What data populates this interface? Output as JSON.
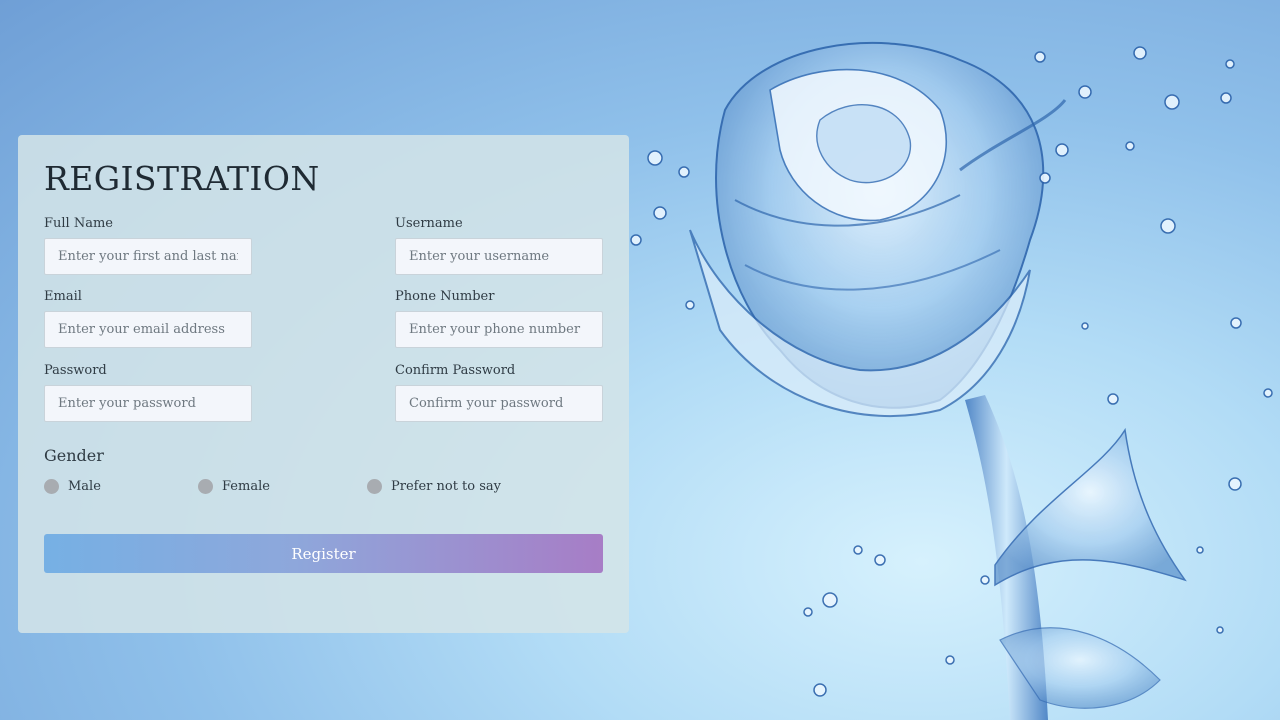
{
  "form": {
    "title": "REGISTRATION",
    "fields": {
      "full_name": {
        "label": "Full Name",
        "placeholder": "Enter your first and last name"
      },
      "username": {
        "label": "Username",
        "placeholder": "Enter your username"
      },
      "email": {
        "label": "Email",
        "placeholder": "Enter your email address"
      },
      "phone": {
        "label": "Phone Number",
        "placeholder": "Enter your phone number"
      },
      "password": {
        "label": "Password",
        "placeholder": "Enter your password"
      },
      "confirm_password": {
        "label": "Confirm Password",
        "placeholder": "Confirm your password"
      }
    },
    "gender": {
      "title": "Gender",
      "options": [
        "Male",
        "Female",
        "Prefer not to say"
      ]
    },
    "submit_label": "Register"
  },
  "colors": {
    "button_gradient_start": "#76b0e4",
    "button_gradient_end": "#a77dc6",
    "radio_unselected": "#a8acb1"
  },
  "background": {
    "icon": "water-rose-illustration"
  }
}
